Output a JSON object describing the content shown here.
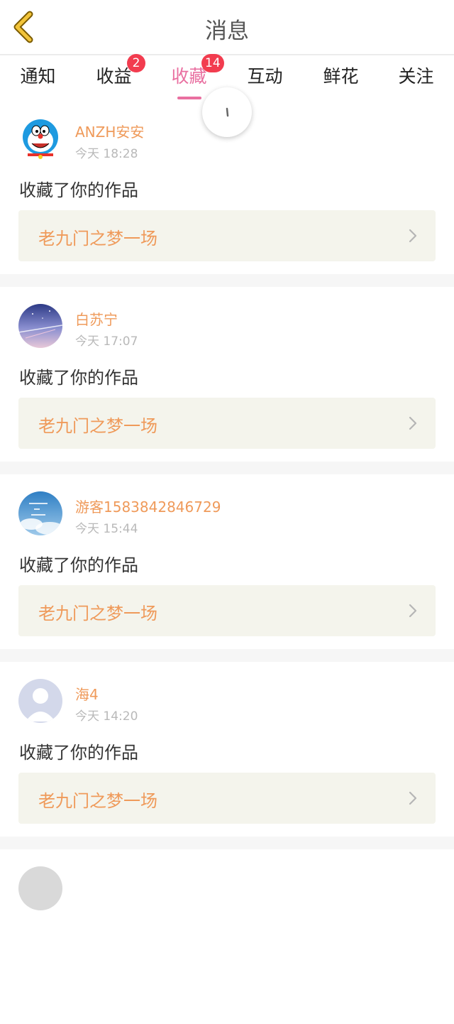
{
  "header": {
    "title": "消息"
  },
  "tabs": [
    {
      "label": "通知",
      "badge": ""
    },
    {
      "label": "收益",
      "badge": "2"
    },
    {
      "label": "收藏",
      "badge": "14"
    },
    {
      "label": "互动",
      "badge": ""
    },
    {
      "label": "鲜花",
      "badge": ""
    },
    {
      "label": "关注",
      "badge": ""
    }
  ],
  "active_tab": "收藏",
  "messages": [
    {
      "user": "ANZH安安",
      "time": "今天 18:28",
      "action": "收藏了你的作品",
      "work": "老九门之梦一场"
    },
    {
      "user": "白苏宁",
      "time": "今天 17:07",
      "action": "收藏了你的作品",
      "work": "老九门之梦一场"
    },
    {
      "user": "游客1583842846729",
      "time": "今天 15:44",
      "action": "收藏了你的作品",
      "work": "老九门之梦一场"
    },
    {
      "user": "海4",
      "time": "今天 14:20",
      "action": "收藏了你的作品",
      "work": "老九门之梦一场"
    }
  ],
  "colors": {
    "accent_pink": "#e96fa0",
    "username_orange": "#ef9a5a",
    "badge_red": "#f23c4f",
    "back_yellow": "#f2c43a"
  }
}
